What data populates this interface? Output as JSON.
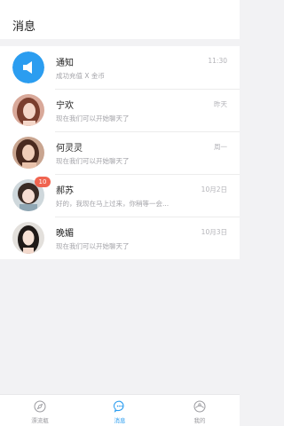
{
  "header": {
    "title": "消息"
  },
  "conversations": [
    {
      "name": "通知",
      "preview": "成功充值 X 金币",
      "time": "11:30",
      "badge": ""
    },
    {
      "name": "宁欢",
      "preview": "现在我们可以开始聊天了",
      "time": "昨天",
      "badge": ""
    },
    {
      "name": "何灵灵",
      "preview": "现在我们可以开始聊天了",
      "time": "周一",
      "badge": ""
    },
    {
      "name": "郝苏",
      "preview": "好的，我现在马上过来，你稍等一会...",
      "time": "10月2日",
      "badge": "10"
    },
    {
      "name": "晚媚",
      "preview": "现在我们可以开始聊天了",
      "time": "10月3日",
      "badge": ""
    }
  ],
  "tabbar": {
    "items": [
      {
        "label": "漂流瓶",
        "icon": "compass-icon",
        "active": false
      },
      {
        "label": "消息",
        "icon": "chat-bubble-icon",
        "active": true
      },
      {
        "label": "我的",
        "icon": "profile-icon",
        "active": false
      }
    ]
  },
  "colors": {
    "accent": "#2b9df0",
    "badge": "#f06450",
    "background": "#f2f2f4"
  }
}
